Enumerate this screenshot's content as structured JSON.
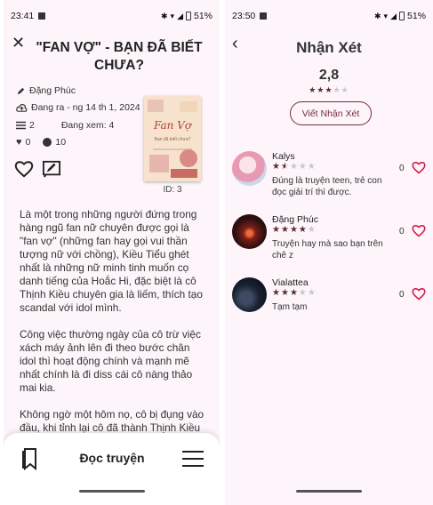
{
  "left_screen": {
    "status": {
      "time": "23:41",
      "battery": "51%"
    },
    "title": "\"FAN VỢ\" - BẠN ĐÃ BIẾT CHƯA?",
    "author": "Đặng Phúc",
    "status_update": "Đang ra - ng 14 th 1, 2024",
    "chapters": "2",
    "views": "Đang xem: 4",
    "likes": "0",
    "comments": "10",
    "cover": {
      "title": "Fan Vợ",
      "subtitle": "Bạn đã biết chưa?"
    },
    "id_label": "ID: 3",
    "paragraphs": [
      "Là một trong những người đứng trong hàng ngũ fan nữ chuyên được gọi là \"fan vợ\" (những fan hay gọi vui thần tượng nữ với chồng), Kiều Tiểu ghét nhất là những nữ minh tinh muốn cọ danh tiếng của Hoắc Hi, đặc biệt là cô Thịnh Kiều chuyên gia là liếm, thích tạo scandal với idol mình.",
      "Công việc thường ngày của cô trừ việc xách máy ảnh lên đi theo bước chân idol thì hoạt động chính và mạnh mẽ nhất chính là đi diss cái cô nàng thảo mai kia.",
      "Không ngờ một hôm nọ, cô bị đụng vào đầu, khi tỉnh lại cô đã thành Thịnh Kiều @*@"
    ],
    "read_button": "Đọc truyện"
  },
  "right_screen": {
    "status": {
      "time": "23:50",
      "battery": "51%"
    },
    "title": "Nhận Xét",
    "score": "2,8",
    "score_stars": 3,
    "write_button": "Viết Nhận Xét",
    "reviews": [
      {
        "name": "Kalys",
        "stars": 1.5,
        "text": "Đúng là truyện teen, trẻ con đọc giải trí thì được.",
        "likes": "0"
      },
      {
        "name": "Đặng Phúc",
        "stars": 4,
        "text": "Truyện hay mà sao bạn trên chê z",
        "likes": "0"
      },
      {
        "name": "Vialattea",
        "stars": 3,
        "text": "Tạm tạm",
        "likes": "0"
      }
    ]
  },
  "colors": {
    "accent": "#7a2a3d",
    "heart": "#d81b4a",
    "background": "#fdf5f9"
  }
}
